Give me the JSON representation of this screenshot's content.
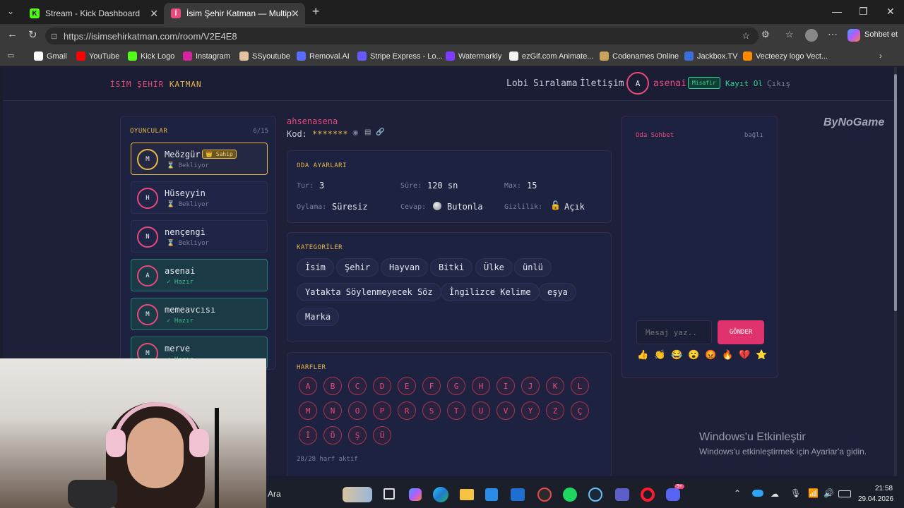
{
  "browser": {
    "tabs": [
      {
        "title": "Stream - Kick Dashboard",
        "active": false
      },
      {
        "title": "İsim Şehir Katman — Multiplayer İ",
        "active": true
      }
    ],
    "url": "https://isimsehirkatman.com/room/V2E4E8",
    "profile_label": "Sohbet et",
    "bookmarks": [
      "Gmail",
      "YouTube",
      "Kick Logo",
      "Instagram",
      "SSyoutube",
      "Removal.AI",
      "Stripe Express - Lo...",
      "Watermarkly",
      "ezGif.com Animate...",
      "Codenames Online",
      "Jackbox.TV",
      "Vecteezy logo Vect..."
    ]
  },
  "site": {
    "logo_part1": "İSİM ŞEHİR",
    "logo_part2": "KATMAN",
    "nav": [
      "Lobi",
      "Sıralama",
      "İletişim"
    ],
    "user_initial": "A",
    "username": "asenai",
    "guest_badge": "Misafir",
    "register": "Kayıt Ol",
    "logout": "Çıkış"
  },
  "players": {
    "title": "OYUNCULAR",
    "count": "6/15",
    "list": [
      {
        "initial": "M",
        "name": "Meözgür",
        "status": "⌛ Bekliyor",
        "owner_badge": "👑 Sahip"
      },
      {
        "initial": "H",
        "name": "Hüseyyin",
        "status": "⌛ Bekliyor"
      },
      {
        "initial": "N",
        "name": "nençengi",
        "status": "⌛ Bekliyor"
      },
      {
        "initial": "A",
        "name": "asenai",
        "status": "✓ Hazır"
      },
      {
        "initial": "M",
        "name": "memeavcısı",
        "status": "✓ Hazır"
      },
      {
        "initial": "M",
        "name": "merve",
        "status": "✓ Hazır"
      }
    ]
  },
  "room": {
    "owner_name": "ahsenasena",
    "code_label": "Kod:",
    "code_value": "*******",
    "settings_title": "ODA AYARLARI",
    "settings": {
      "tur_label": "Tur:",
      "tur": "3",
      "sure_label": "Süre:",
      "sure": "120 sn",
      "max_label": "Max:",
      "max": "15",
      "oylama_label": "Oylama:",
      "oylama": "Süresiz",
      "cevap_label": "Cevap:",
      "cevap": "Butonla",
      "gizlilik_label": "Gizlilik:",
      "gizlilik": "Açık"
    },
    "categories_title": "KATEGORİLER",
    "categories": [
      "İsim",
      "Şehir",
      "Hayvan",
      "Bitki",
      "Ülke",
      "ünlü",
      "Yatakta Söylenmeyecek Söz",
      "İngilizce Kelime",
      "eşya",
      "Marka"
    ],
    "letters_title": "HARFLER",
    "letters": [
      "A",
      "B",
      "C",
      "D",
      "E",
      "F",
      "G",
      "H",
      "I",
      "J",
      "K",
      "L",
      "M",
      "N",
      "O",
      "P",
      "R",
      "S",
      "T",
      "U",
      "V",
      "Y",
      "Z",
      "Ç",
      "İ",
      "Ö",
      "Ş",
      "Ü"
    ],
    "letters_status": "28/28 harf aktif"
  },
  "chat": {
    "title": "Oda Sohbet",
    "status": "bağlı",
    "placeholder": "Mesaj yaz..",
    "send": "GÖNDER",
    "emojis": [
      "👍",
      "👏",
      "😂",
      "😮",
      "😡",
      "🔥",
      "💔",
      "⭐"
    ]
  },
  "brand_watermark": "ByNoGame",
  "activation": {
    "title": "Windows'u Etkinleştir",
    "subtitle": "Windows'u etkinleştirmek için Ayarlar'a gidin."
  },
  "taskbar": {
    "search": "Ara",
    "time": "21:58",
    "date": "29.04.2026",
    "notification_count": "9+"
  }
}
